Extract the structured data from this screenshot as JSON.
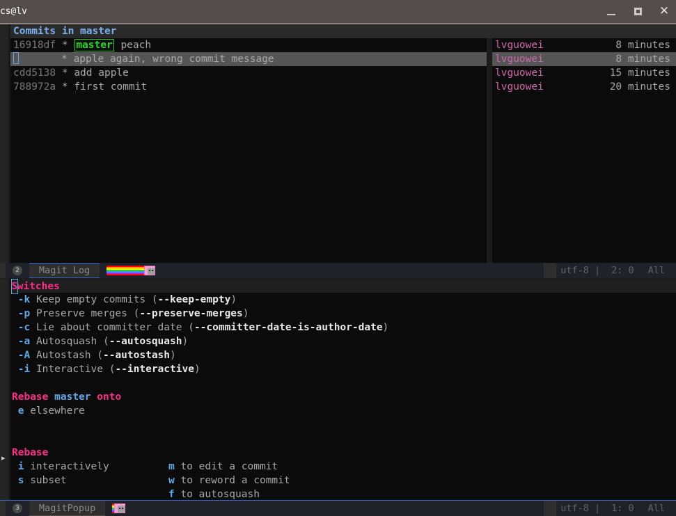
{
  "window": {
    "title": "acs@lv",
    "controls": {
      "minimize": "minimize",
      "maximize": "maximize",
      "close": "close"
    }
  },
  "log_window": {
    "header": "Commits in master",
    "columns": [
      "hash",
      "graph",
      "ref",
      "message",
      "author",
      "age"
    ],
    "commits": [
      {
        "hash": "16918df",
        "graph": "*",
        "ref": "master",
        "message": "peach",
        "author": "lvguowei",
        "age": "8 minutes",
        "selected": false,
        "cursor": false
      },
      {
        "hash": "",
        "graph": "*",
        "ref": "",
        "message": "apple again, wrong commit message",
        "author": "lvguowei",
        "age": "8 minutes",
        "selected": true,
        "cursor": true
      },
      {
        "hash": "cdd5138",
        "graph": "*",
        "ref": "",
        "message": "add apple",
        "author": "lvguowei",
        "age": "15 minutes",
        "selected": false,
        "cursor": false
      },
      {
        "hash": "788972a",
        "graph": "*",
        "ref": "",
        "message": "first commit",
        "author": "lvguowei",
        "age": "20 minutes",
        "selected": false,
        "cursor": false
      }
    ]
  },
  "modeline_log": {
    "badge": "2",
    "buffer_name": "Magit Log",
    "indicator_icon": "nyan-cat-progress",
    "coding": "utf-8 |",
    "position": "2: 0",
    "scroll": "All"
  },
  "popup": {
    "switches": {
      "title": "Switches",
      "title_cursor_char": "S",
      "items": [
        {
          "key": "-k",
          "label": "Keep empty commits",
          "arg": "--keep-empty"
        },
        {
          "key": "-p",
          "label": "Preserve merges",
          "arg": "--preserve-merges"
        },
        {
          "key": "-c",
          "label": "Lie about committer date",
          "arg": "--committer-date-is-author-date"
        },
        {
          "key": "-a",
          "label": "Autosquash",
          "arg": "--autosquash"
        },
        {
          "key": "-A",
          "label": "Autostash",
          "arg": "--autostash"
        },
        {
          "key": "-i",
          "label": "Interactive",
          "arg": "--interactive"
        }
      ]
    },
    "rebase_onto": {
      "title_prefix": "Rebase",
      "title_branch": "master",
      "title_suffix": "onto",
      "items": [
        {
          "key": "e",
          "label": "elsewhere"
        }
      ]
    },
    "rebase": {
      "title": "Rebase",
      "left_items": [
        {
          "key": "i",
          "label": "interactively"
        },
        {
          "key": "s",
          "label": "subset"
        }
      ],
      "right_items": [
        {
          "key": "m",
          "label": "to edit a commit"
        },
        {
          "key": "w",
          "label": "to reword a commit"
        },
        {
          "key": "f",
          "label": "to autosquash"
        }
      ]
    },
    "fringe_arrow": "▸"
  },
  "modeline_popup": {
    "badge": "3",
    "buffer_name": "MagitPopup",
    "indicator_icon": "nyan-cat-progress",
    "coding": "utf-8 |",
    "position": "1: 0",
    "scroll": "All"
  },
  "colors": {
    "accent_blue": "#5fa8e8",
    "accent_pink": "#ff2d8a",
    "branch_green": "#22dd22",
    "author_pink": "#d166a8",
    "modeline_border": "#2a6ad0"
  }
}
